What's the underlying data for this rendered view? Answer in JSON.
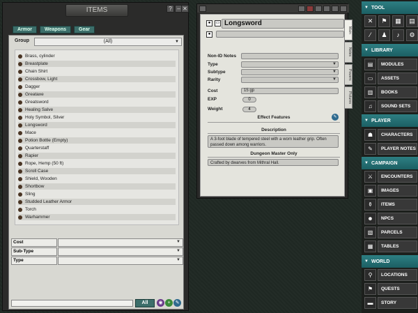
{
  "items_window": {
    "title": "ITEMS",
    "tabs": [
      "Armor",
      "Weapons",
      "Gear"
    ],
    "group_label": "Group",
    "group_value": "(All)",
    "items": [
      "Brass, cylinder",
      "Breastplate",
      "Chain Shirt",
      "Crossbow, Light",
      "Dagger",
      "Greataxe",
      "Greatsword",
      "Healing Salve",
      "Holy Symbol, Silver",
      "Longsword",
      "Mace",
      "Potion Bottle (Empty)",
      "Quarterstaff",
      "Rapier",
      "Rope, Hemp (50 ft)",
      "Scroll Case",
      "Shield, Wooden",
      "Shortbow",
      "Sling",
      "Studded Leather Armor",
      "Torch",
      "Warhammer"
    ],
    "filters": [
      "Cost",
      "Sub-Type",
      "Type"
    ],
    "all_button": "All"
  },
  "sword_window": {
    "name": "Longsword",
    "labels": {
      "non_id": "Non-ID Notes",
      "type": "Type",
      "subtype": "Subtype",
      "rarity": "Rarity",
      "cost": "Cost",
      "exp": "EXP",
      "weight": "Weight"
    },
    "cost_value": "15 gp",
    "exp_value": "0",
    "weight_value": "4",
    "effect_features": "Effect Features",
    "description_head": "Description",
    "description": "A 3-foot blade of tempered steel with a worn leather grip. Often passed down among warriors.",
    "dm_head": "Dungeon Master Only",
    "dm_text": "Crafted by dwarves from Mithral Hall.",
    "side_tabs": [
      "Main",
      "Notes",
      "Powers",
      "Pictures"
    ]
  },
  "sidebar": {
    "tool_header": "TOOL",
    "tool_icons": [
      "✕",
      "⚑",
      "▦",
      "▤",
      "⁄",
      "♟",
      "♪",
      "⚙"
    ],
    "library_header": "LIBRARY",
    "library": [
      {
        "label": "MODULES",
        "icon": "▤"
      },
      {
        "label": "ASSETS",
        "icon": "▭"
      },
      {
        "label": "BOOKS",
        "icon": "▥"
      },
      {
        "label": "SOUND SETS",
        "icon": "♫"
      }
    ],
    "player_header": "PLAYER",
    "player": [
      {
        "label": "CHARACTERS",
        "icon": "☗"
      },
      {
        "label": "PLAYER NOTES",
        "icon": "✎"
      }
    ],
    "campaign_header": "CAMPAIGN",
    "campaign": [
      {
        "label": "ENCOUNTERS",
        "icon": "⚔"
      },
      {
        "label": "IMAGES",
        "icon": "▣"
      },
      {
        "label": "ITEMS",
        "icon": "⚱"
      },
      {
        "label": "NPCS",
        "icon": "☻"
      },
      {
        "label": "PARCELS",
        "icon": "▧"
      },
      {
        "label": "TABLES",
        "icon": "▦"
      }
    ],
    "world_header": "WORLD",
    "world": [
      {
        "label": "LOCATIONS",
        "icon": "⚲"
      },
      {
        "label": "QUESTS",
        "icon": "⚑"
      },
      {
        "label": "STORY",
        "icon": "▬"
      }
    ]
  }
}
